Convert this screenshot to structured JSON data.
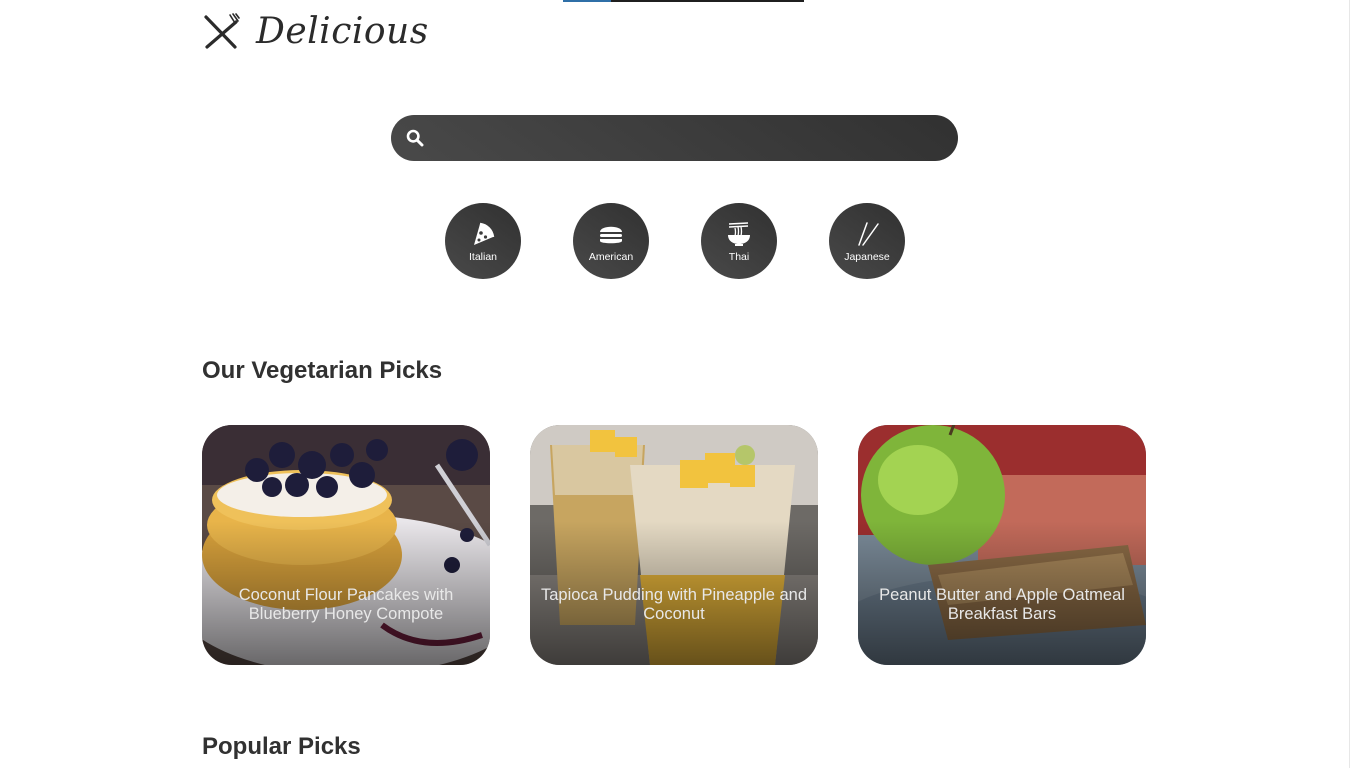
{
  "brand": {
    "name": "Delicious",
    "icon": "fork-knife-crossed-icon"
  },
  "search": {
    "icon": "search-icon",
    "value": ""
  },
  "cuisines": [
    {
      "label": "Italian",
      "icon": "pizza-icon"
    },
    {
      "label": "American",
      "icon": "burger-icon"
    },
    {
      "label": "Thai",
      "icon": "noodle-bowl-icon"
    },
    {
      "label": "Japanese",
      "icon": "chopsticks-icon"
    }
  ],
  "sections": {
    "vegetarian_title": "Our Vegetarian Picks",
    "popular_title": "Popular Picks"
  },
  "vegetarian_picks": [
    {
      "title": "Coconut Flour Pancakes with Blueberry Honey Compote"
    },
    {
      "title": "Tapioca Pudding with Pineapple and Coconut"
    },
    {
      "title": "Peanut Butter and Apple Oatmeal Breakfast Bars"
    }
  ],
  "colors": {
    "dark_gradient_start": "#494949",
    "dark_gradient_end": "#313131",
    "text": "#313131"
  }
}
